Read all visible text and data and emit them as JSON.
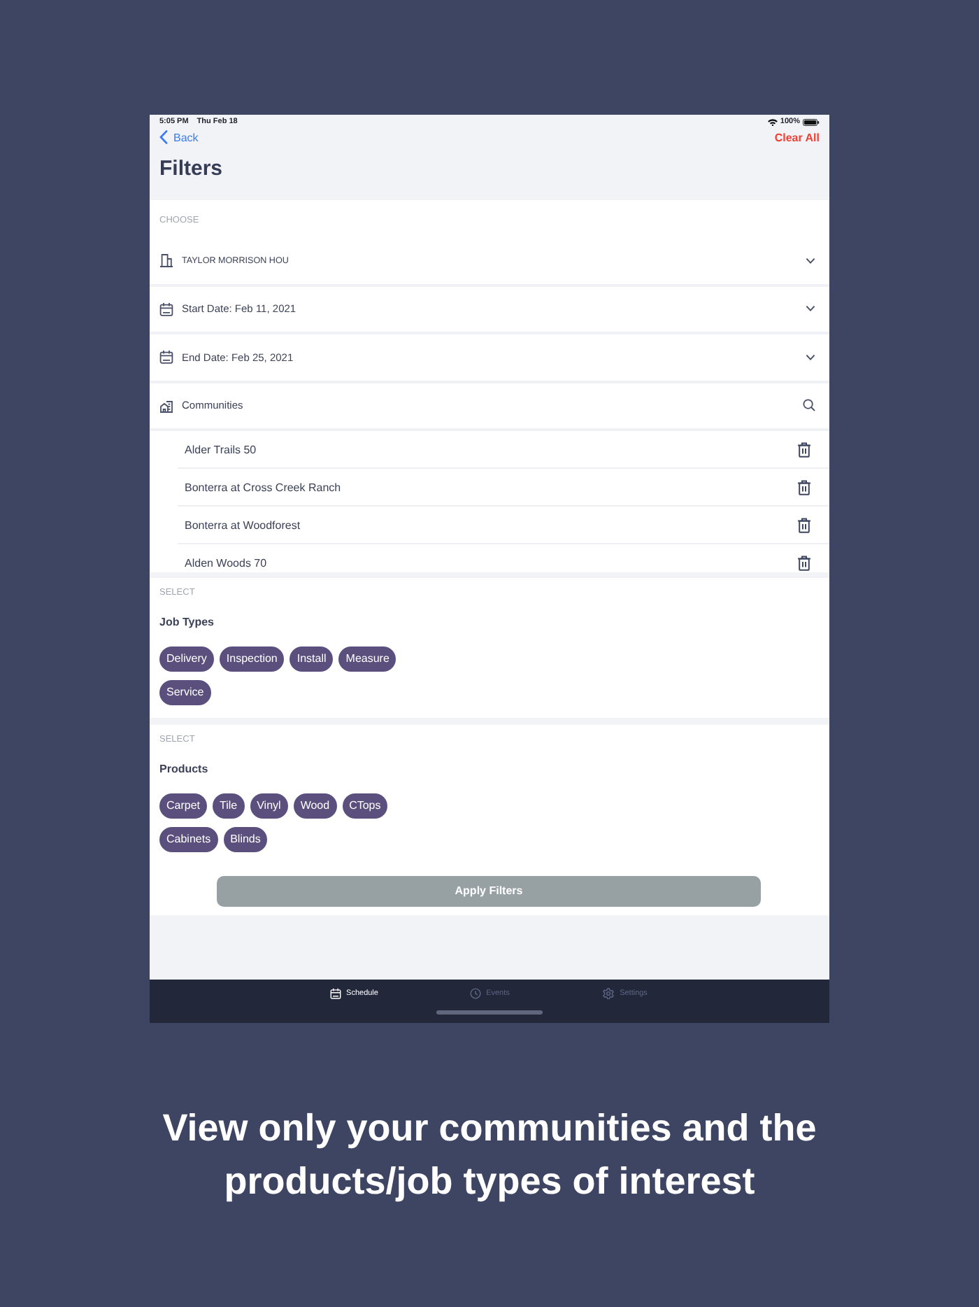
{
  "status_bar": {
    "time": "5:05 PM",
    "date": "Thu Feb 18",
    "battery": "100%"
  },
  "nav": {
    "back": "Back",
    "action": "Clear All",
    "title": "Filters"
  },
  "choose": {
    "label": "CHOOSE",
    "rows": [
      {
        "kind": "dropdown",
        "text": "TAYLOR MORRISON HOU"
      },
      {
        "kind": "dropdown",
        "text": "Start Date: Feb 11, 2021"
      },
      {
        "kind": "dropdown",
        "text": "End Date: Feb 25, 2021"
      },
      {
        "kind": "search",
        "text": "Communities"
      }
    ],
    "communities": [
      "Alder Trails 50",
      "Bonterra at Cross Creek Ranch",
      "Bonterra at Woodforest",
      "Alden Woods 70"
    ]
  },
  "job_types": {
    "label": "SELECT",
    "title": "Job Types",
    "chips": [
      {
        "label": "Delivery",
        "selected": true
      },
      {
        "label": "Inspection",
        "selected": true
      },
      {
        "label": "Install",
        "selected": true
      },
      {
        "label": "Measure",
        "selected": true
      },
      {
        "label": "Service",
        "selected": true
      }
    ]
  },
  "products": {
    "label": "SELECT",
    "title": "Products",
    "chips": [
      {
        "label": "Carpet",
        "selected": true
      },
      {
        "label": "Tile",
        "selected": true
      },
      {
        "label": "Vinyl",
        "selected": true
      },
      {
        "label": "Wood",
        "selected": true
      },
      {
        "label": "CTops",
        "selected": true
      },
      {
        "label": "Cabinets",
        "selected": true
      },
      {
        "label": "Blinds",
        "selected": true
      }
    ]
  },
  "apply_button": "Apply Filters",
  "tab_bar": [
    {
      "label": "Schedule",
      "selected": true
    },
    {
      "label": "Events",
      "selected": false
    },
    {
      "label": "Settings",
      "selected": false
    }
  ],
  "caption": "View only your communities and the products/job types of interest"
}
